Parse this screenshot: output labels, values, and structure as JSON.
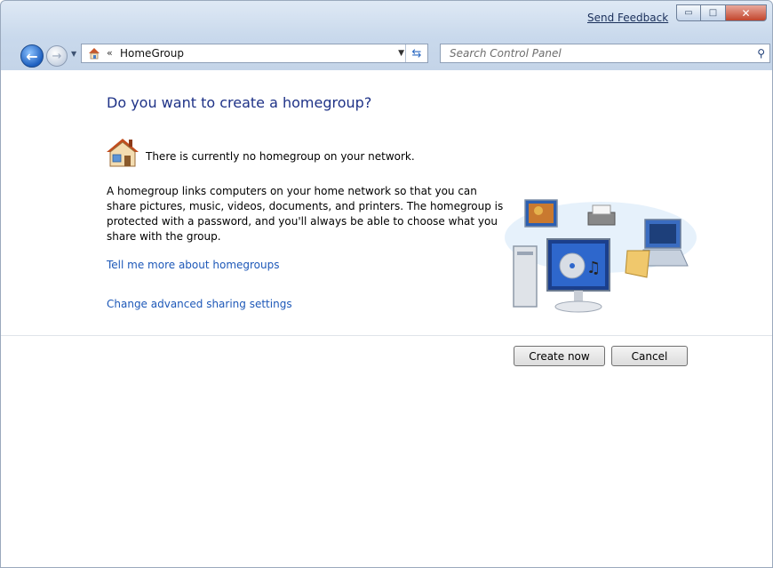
{
  "titlebar": {
    "feedback": "Send Feedback",
    "minimize_icon": "minimize-icon",
    "maximize_icon": "maximize-icon",
    "close_icon": "close-icon"
  },
  "navbar": {
    "back_icon": "back-arrow-icon",
    "forward_icon": "forward-arrow-icon",
    "address_chevron": "«",
    "address_text": "HomeGroup",
    "search_placeholder": "Search Control Panel"
  },
  "main": {
    "title": "Do you want to create a homegroup?",
    "status": "There is currently no homegroup on your network.",
    "description": "A homegroup links computers on your home network so that you can share pictures, music, videos, documents, and printers. The homegroup is protected with a password, and you'll always be able to choose what you share with the group.",
    "link_more": "Tell me more about homegroups",
    "link_advanced": "Change advanced sharing settings"
  },
  "buttons": {
    "create": "Create now",
    "cancel": "Cancel"
  }
}
